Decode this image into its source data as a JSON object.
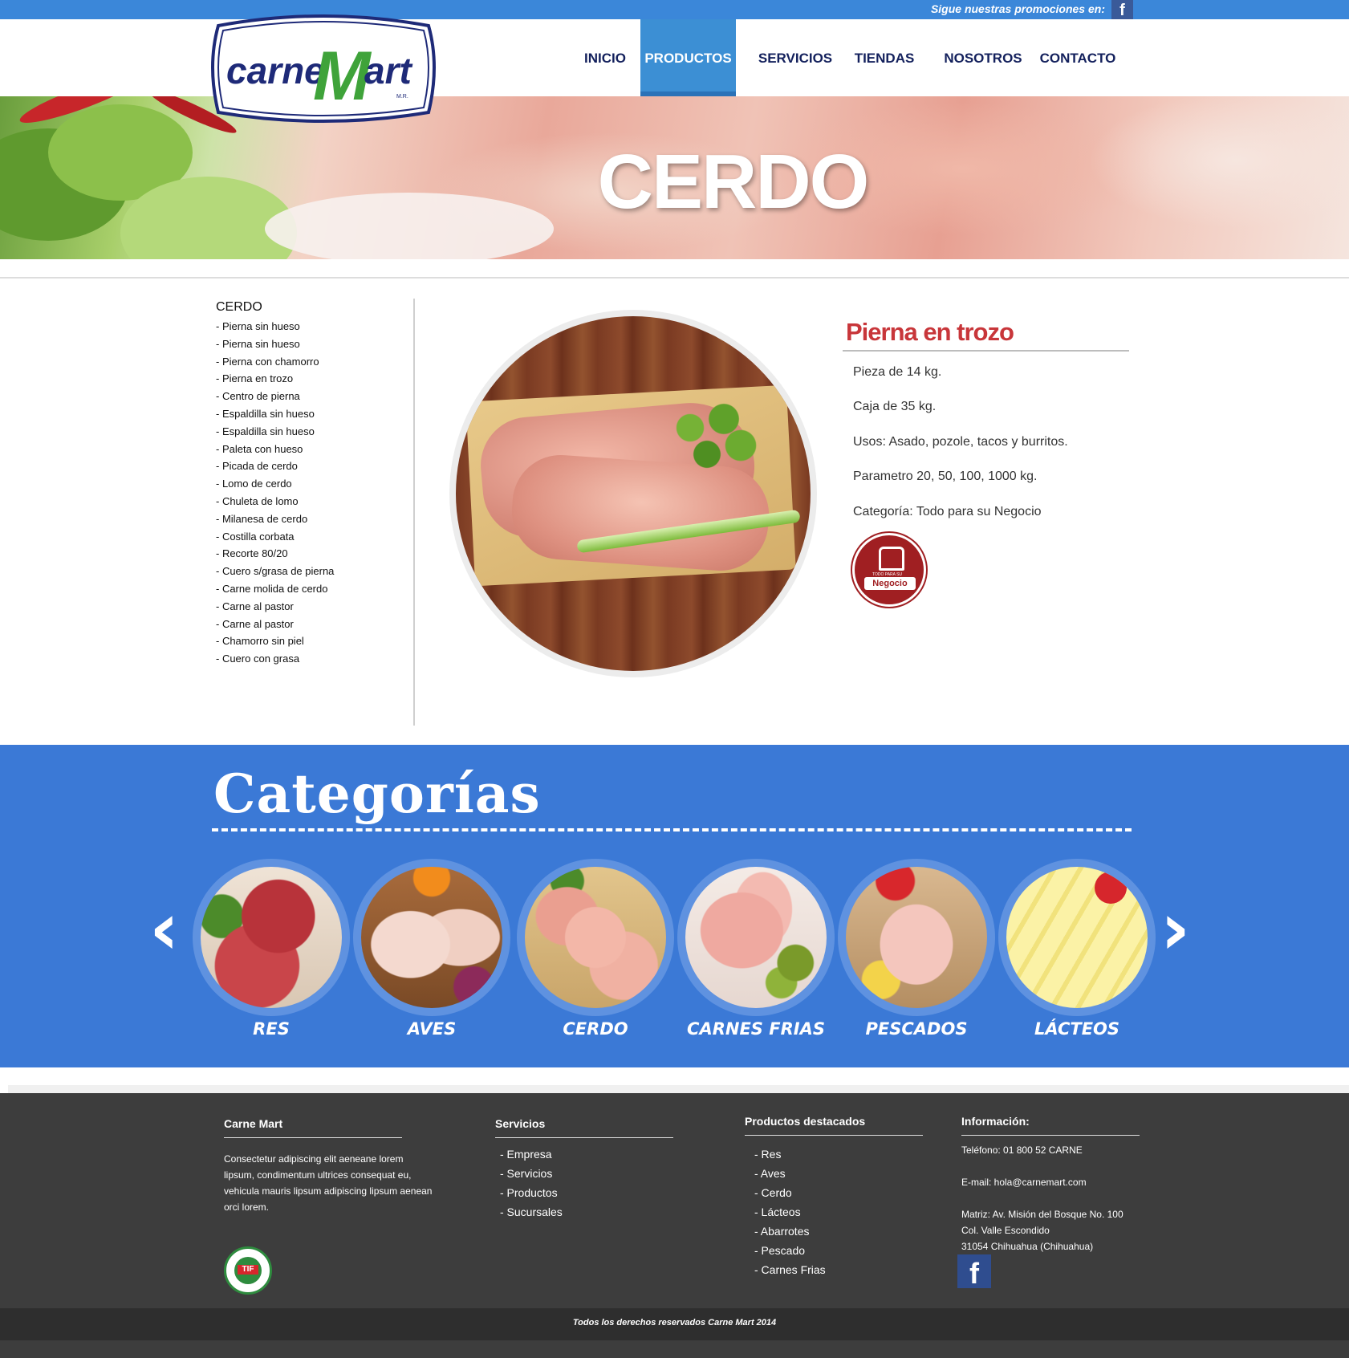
{
  "topbar": {
    "promo_text": "Sigue nuestras promociones en:",
    "facebook_glyph": "f"
  },
  "brand": {
    "name_part1": "carne",
    "name_part2": "Mart",
    "mark": "M.R."
  },
  "nav": [
    "INICIO",
    "PRODUCTOS",
    "SERVICIOS",
    "TIENDAS",
    "NOSOTROS",
    "CONTACTO"
  ],
  "nav_active": "PRODUCTOS",
  "hero": {
    "title": "CERDO"
  },
  "sidebar": {
    "title": "CERDO",
    "items": [
      "- Pierna sin hueso",
      "- Pierna sin hueso",
      "- Pierna con chamorro",
      "- Pierna en trozo",
      "- Centro de pierna",
      "- Espaldilla sin hueso",
      "- Espaldilla sin hueso",
      "- Paleta con hueso",
      "- Picada de cerdo",
      "- Lomo de cerdo",
      "- Chuleta de lomo",
      "- Milanesa de cerdo",
      "- Costilla corbata",
      "- Recorte 80/20",
      "- Cuero s/grasa de pierna",
      "- Carne molida de cerdo",
      "- Carne al pastor",
      "- Carne al pastor",
      "- Chamorro sin piel",
      "- Cuero con grasa"
    ]
  },
  "product": {
    "title": "Pierna en trozo",
    "details": [
      "Pieza de 14 kg.",
      "Caja de 35 kg.",
      "Usos: Asado, pozole, tacos y burritos.",
      "Parametro 20, 50, 100, 1000 kg.",
      "Categoría: Todo para su Negocio"
    ],
    "badge_small": "TODO PARA SU",
    "badge_label": "Negocio"
  },
  "categories": {
    "title": "Categorías",
    "prev_glyph": "‹",
    "next_glyph": "›",
    "items": [
      {
        "label": "RES"
      },
      {
        "label": "AVES"
      },
      {
        "label": "CERDO"
      },
      {
        "label": "CARNES FRIAS"
      },
      {
        "label": "PESCADOS"
      },
      {
        "label": "LÁCTEOS"
      }
    ]
  },
  "footer": {
    "col1": {
      "title": "Carne Mart",
      "text": "Consectetur adipiscing elit aeneane lorem lipsum, condimentum ultrices consequat eu, vehicula mauris lipsum adipiscing lipsum aenean orci lorem."
    },
    "col2": {
      "title": "Servicios",
      "items": [
        "- Empresa",
        "- Servicios",
        "- Productos",
        "- Sucursales"
      ]
    },
    "col3": {
      "title": "Productos destacados",
      "items": [
        "- Res",
        "- Aves",
        "- Cerdo",
        "- Lácteos",
        "- Abarrotes",
        "- Pescado",
        "- Carnes Frias"
      ]
    },
    "col4": {
      "title": "Información:",
      "phone": "Teléfono: 01 800 52 CARNE",
      "email": "E-mail: hola@carnemart.com",
      "address1": "Matriz: Av. Misión del Bosque No. 100",
      "address2": "Col. Valle Escondido",
      "address3": "31054 Chihuahua (Chihuahua)"
    },
    "tif_label": "TIF",
    "facebook_glyph": "f",
    "copyright": "Todos los derechos reservados Carne Mart 2014"
  },
  "colors": {
    "topbar": "#3b87d9",
    "nav_text": "#13205c",
    "nav_active": "#3c8fd4",
    "product_title": "#c8363a",
    "categories_bg": "#3b79d6",
    "footer_bg": "#3d3d3d"
  }
}
